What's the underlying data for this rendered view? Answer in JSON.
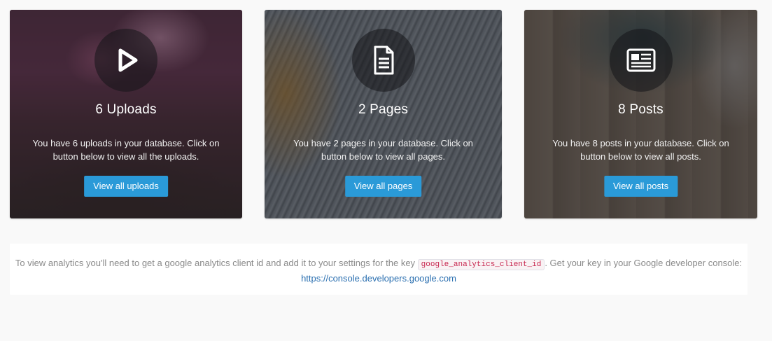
{
  "cards": [
    {
      "id": "uploads",
      "icon": "play-icon",
      "title": "6 Uploads",
      "text": "You have 6 uploads in your database. Click on button below to view all the uploads.",
      "button": "View all uploads"
    },
    {
      "id": "pages",
      "icon": "document-icon",
      "title": "2 Pages",
      "text": "You have 2 pages in your database. Click on button below to view all pages.",
      "button": "View all pages"
    },
    {
      "id": "posts",
      "icon": "newspaper-icon",
      "title": "8 Posts",
      "text": "You have 8 posts in your database. Click on button below to view all posts.",
      "button": "View all posts"
    }
  ],
  "notice": {
    "text_before": "To view analytics you'll need to get a google analytics client id and add it to your settings for the key ",
    "key": "google_analytics_client_id",
    "text_after": ". Get your key in your Google developer console:",
    "link": "https://console.developers.google.com"
  },
  "colors": {
    "button": "#2a9ad8",
    "link": "#2a6fb0",
    "code_text": "#c7254e",
    "page_background": "#f9f9f9"
  }
}
